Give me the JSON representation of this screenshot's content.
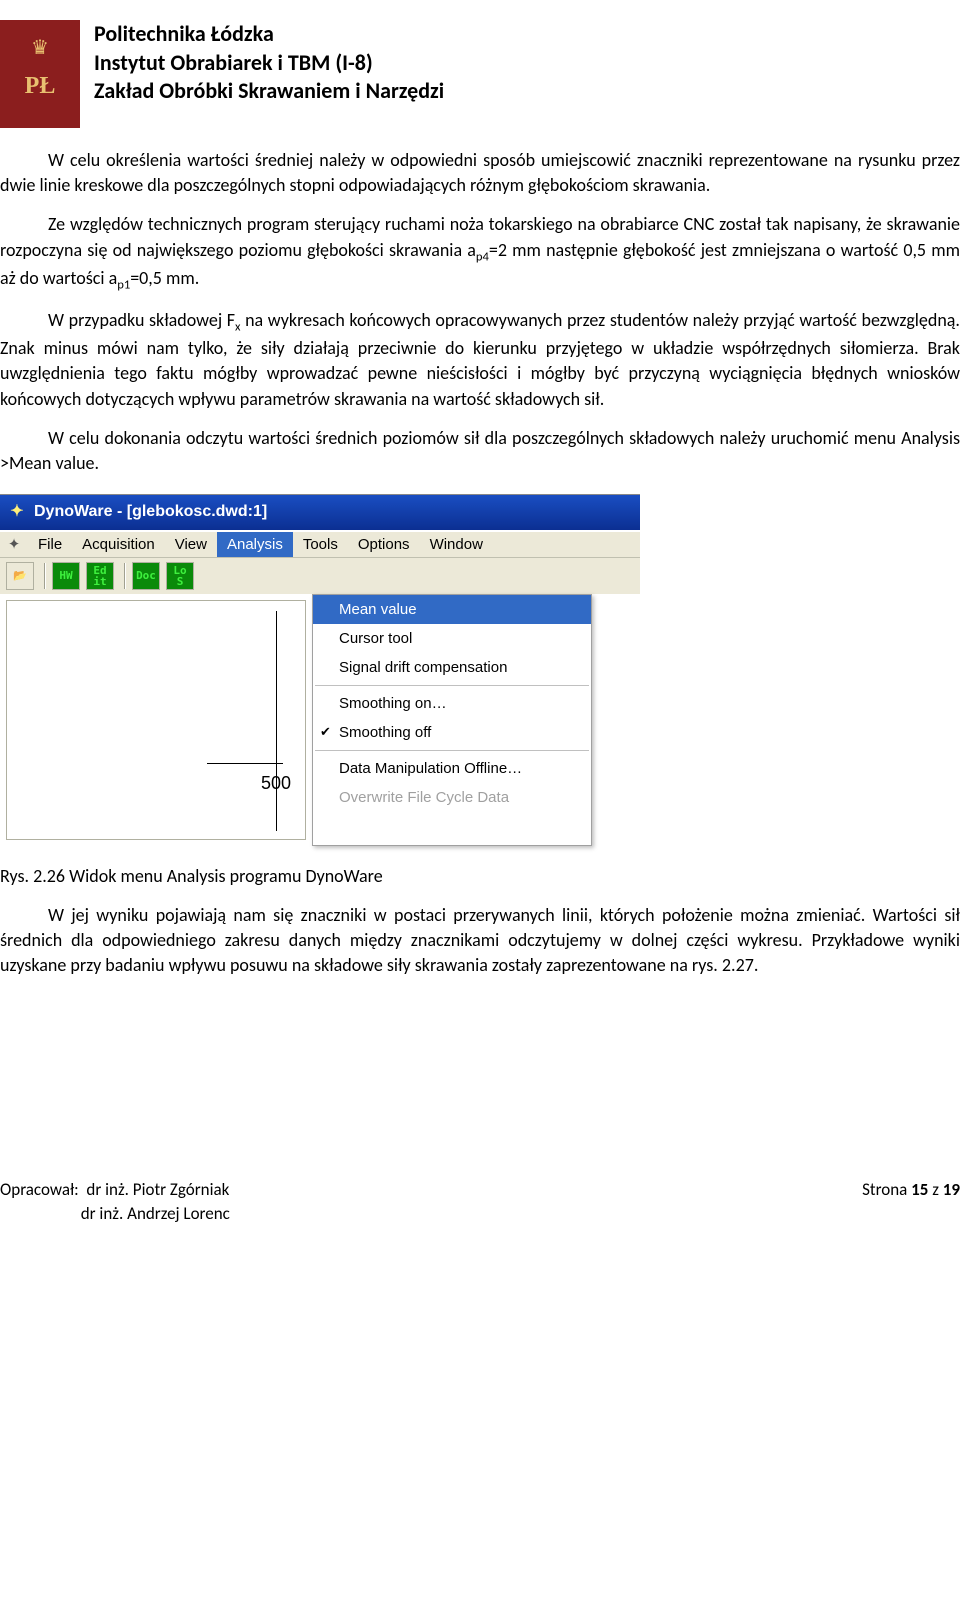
{
  "header": {
    "line1": "Politechnika Łódzka",
    "line2": "Instytut Obrabiarek i TBM (I-8)",
    "line3": "Zakład Obróbki Skrawaniem i Narzędzi",
    "logo_letters": "PŁ"
  },
  "paragraphs": {
    "p1": "W celu określenia wartości średniej należy w odpowiedni sposób umiejscowić znaczniki reprezentowane na rysunku przez dwie linie kreskowe dla poszczególnych stopni odpowiadających różnym głębokościom skrawania.",
    "p2a": "Ze względów technicznych program sterujący ruchami noża tokarskiego na obrabiarce CNC został tak napisany, że skrawanie rozpoczyna się od największego poziomu głębokości skrawania a",
    "p2sub1": "p4",
    "p2b": "=2 mm następnie głębokość jest zmniejszana o wartość 0,5 mm aż do wartości a",
    "p2sub2": "p1",
    "p2c": "=0,5 mm.",
    "p3a": "W przypadku składowej F",
    "p3sub": "x",
    "p3b": " na wykresach końcowych opracowywanych przez studentów należy przyjąć wartość bezwzględną. Znak minus mówi nam tylko, że siły działają przeciwnie do kierunku przyjętego w układzie współrzędnych siłomierza. Brak uwzględnienia tego faktu mógłby wprowadzać pewne nieścisłości i mógłby być przyczyną wyciągnięcia błędnych wniosków końcowych dotyczących wpływu parametrów skrawania na wartość składowych sił.",
    "p4": "W celu dokonania odczytu wartości średnich poziomów sił dla poszczególnych składowych należy uruchomić menu Analysis >Mean value.",
    "p5": "W jej wyniku pojawiają nam się znaczniki w postaci przerywanych linii, których położenie można zmieniać. Wartości sił średnich dla odpowiedniego zakresu danych między znacznikami odczytujemy w dolnej części wykresu. Przykładowe wyniki uzyskane przy badaniu wpływu posuwu na składowe siły skrawania zostały zaprezentowane na rys. 2.27."
  },
  "caption": "Rys. 2.26 Widok menu Analysis programu DynoWare",
  "app": {
    "title": "DynoWare - [glebokosc.dwd:1]",
    "menus": [
      "File",
      "Acquisition",
      "View",
      "Analysis",
      "Tools",
      "Options",
      "Window"
    ],
    "menu_active_index": 3,
    "toolbar": {
      "open": "📂",
      "hw": "HW",
      "ed": "Ed\nit",
      "doc": "Doc",
      "los": "Lo\nS"
    },
    "dropdown": [
      {
        "label": "Mean value",
        "highlight": true
      },
      {
        "label": "Cursor tool"
      },
      {
        "label": "Signal drift compensation"
      },
      {
        "sep": true
      },
      {
        "label": "Smoothing on…"
      },
      {
        "label": "Smoothing off",
        "check": true
      },
      {
        "sep": true
      },
      {
        "label": "Data Manipulation Offline…"
      },
      {
        "label": "Overwrite File Cycle Data",
        "disabled": true
      }
    ],
    "chart_tick_label": "500"
  },
  "footer": {
    "left_label": "Opracował:",
    "left_line1": "dr inż. Piotr Zgórniak",
    "left_line2": "dr inż. Andrzej Lorenc",
    "right_a": "Strona ",
    "right_b": "15",
    "right_c": " z ",
    "right_d": "19"
  }
}
